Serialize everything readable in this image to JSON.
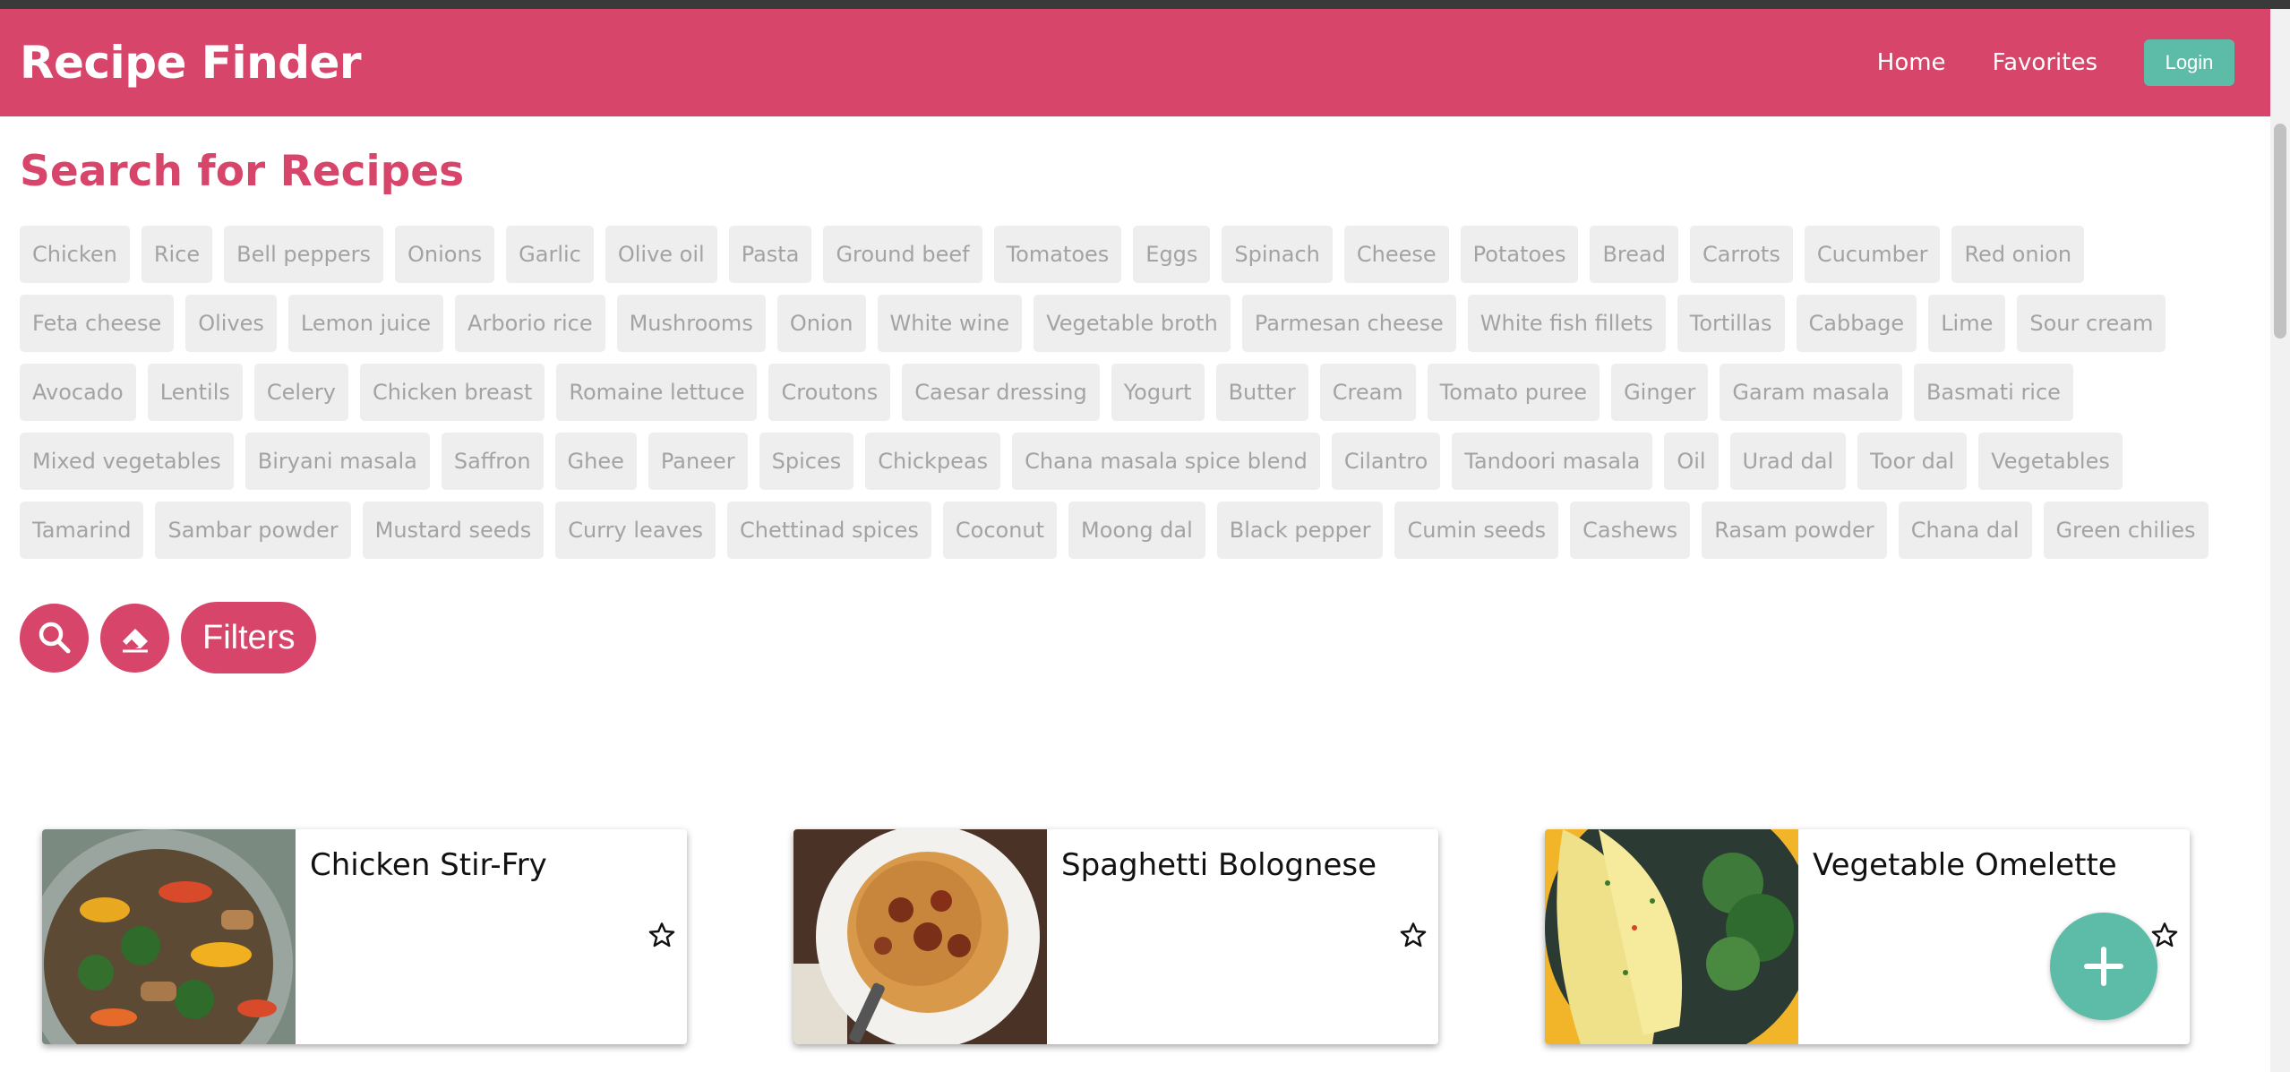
{
  "app": {
    "title": "Recipe Finder"
  },
  "nav": {
    "home": "Home",
    "favorites": "Favorites",
    "login": "Login"
  },
  "search": {
    "heading": "Search for Recipes",
    "ingredients": [
      "Chicken",
      "Rice",
      "Bell peppers",
      "Onions",
      "Garlic",
      "Olive oil",
      "Pasta",
      "Ground beef",
      "Tomatoes",
      "Eggs",
      "Spinach",
      "Cheese",
      "Potatoes",
      "Bread",
      "Carrots",
      "Cucumber",
      "Red onion",
      "Feta cheese",
      "Olives",
      "Lemon juice",
      "Arborio rice",
      "Mushrooms",
      "Onion",
      "White wine",
      "Vegetable broth",
      "Parmesan cheese",
      "White fish fillets",
      "Tortillas",
      "Cabbage",
      "Lime",
      "Sour cream",
      "Avocado",
      "Lentils",
      "Celery",
      "Chicken breast",
      "Romaine lettuce",
      "Croutons",
      "Caesar dressing",
      "Yogurt",
      "Butter",
      "Cream",
      "Tomato puree",
      "Ginger",
      "Garam masala",
      "Basmati rice",
      "Mixed vegetables",
      "Biryani masala",
      "Saffron",
      "Ghee",
      "Paneer",
      "Spices",
      "Chickpeas",
      "Chana masala spice blend",
      "Cilantro",
      "Tandoori masala",
      "Oil",
      "Urad dal",
      "Toor dal",
      "Vegetables",
      "Tamarind",
      "Sambar powder",
      "Mustard seeds",
      "Curry leaves",
      "Chettinad spices",
      "Coconut",
      "Moong dal",
      "Black pepper",
      "Cumin seeds",
      "Cashews",
      "Rasam powder",
      "Chana dal",
      "Green chilies"
    ],
    "filters_label": "Filters"
  },
  "recipes": [
    {
      "title": "Chicken Stir-Fry"
    },
    {
      "title": "Spaghetti Bolognese"
    },
    {
      "title": "Vegetable Omelette"
    }
  ],
  "colors": {
    "brand": "#d8456a",
    "accent": "#5dbca8",
    "chip_bg": "#eeeeee",
    "chip_text": "#a3a3a3"
  },
  "icons": {
    "search": "search-icon",
    "clear": "eraser-icon",
    "favorite": "star-outline-icon",
    "add": "plus-icon"
  }
}
